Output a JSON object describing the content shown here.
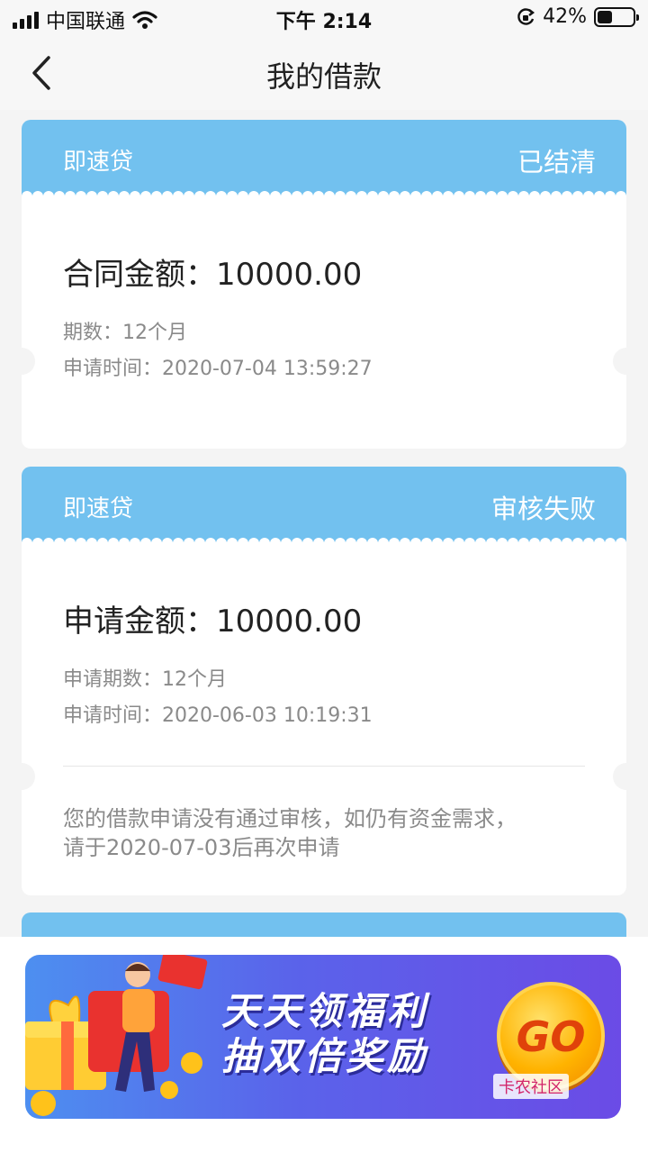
{
  "status_bar": {
    "carrier": "中国联通",
    "time": "下午 2:14",
    "battery": "42%",
    "battery_level": 0.42
  },
  "nav": {
    "title": "我的借款"
  },
  "loans": [
    {
      "product": "即速贷",
      "status": "已结清",
      "amount_label": "合同金额：",
      "amount": "10000.00",
      "details": [
        "期数：12个月",
        "申请时间：2020-07-04 13:59:27"
      ]
    },
    {
      "product": "即速贷",
      "status": "审核失败",
      "amount_label": "申请金额：",
      "amount": "10000.00",
      "details": [
        "申请期数：12个月",
        "申请时间：2020-06-03 10:19:31"
      ],
      "notice_line1": "您的借款申请没有通过审核，如仍有资金需求，",
      "notice_line2": "请于2020-07-03后再次申请"
    }
  ],
  "banner": {
    "line1": "天天领福利",
    "line2": "抽双倍奖励",
    "go": "GO",
    "watermark": "卡农社区"
  },
  "colors": {
    "card_header": "#72c1ef",
    "banner_start": "#4d8ff0",
    "banner_end": "#6b4be6",
    "go": "#ffb300"
  }
}
